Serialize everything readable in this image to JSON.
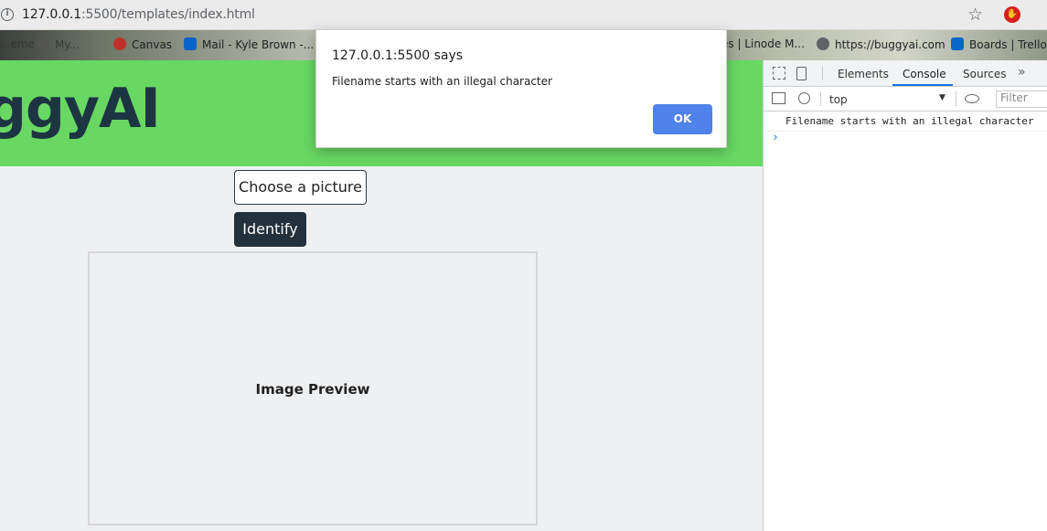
{
  "browser": {
    "url_host": "127.0.0.1",
    "url_path": ":5500/templates/index.html",
    "bookmarks": [
      {
        "label": "...eme",
        "color": "#7a7a7a"
      },
      {
        "label": "My...",
        "color": "#6b6b6b"
      },
      {
        "label": "Canvas",
        "color": "#c0302b"
      },
      {
        "label": "Mail - Kyle Brown -...",
        "color": "#0a64c8"
      },
      {
        "label": "es | Linode M...",
        "color": "#8a8a8a"
      },
      {
        "label": "https://buggyai.com",
        "color": "#5f6368"
      },
      {
        "label": "Boards | Trello",
        "color": "#0a66c8"
      }
    ]
  },
  "page": {
    "brand": "ggyAI",
    "choose_button": "Choose a picture",
    "identify_button": "Identify",
    "preview_label": "Image Preview",
    "colors": {
      "header": "#68d862",
      "dark": "#23313c"
    }
  },
  "dialog": {
    "title": "127.0.0.1:5500 says",
    "message": "Filename starts with an illegal character",
    "ok_label": "OK"
  },
  "devtools": {
    "tabs": [
      "Elements",
      "Console",
      "Sources"
    ],
    "active_tab": "Console",
    "context": "top",
    "filter_placeholder": "Filter",
    "console_messages": [
      "Filename starts with an illegal character"
    ]
  }
}
